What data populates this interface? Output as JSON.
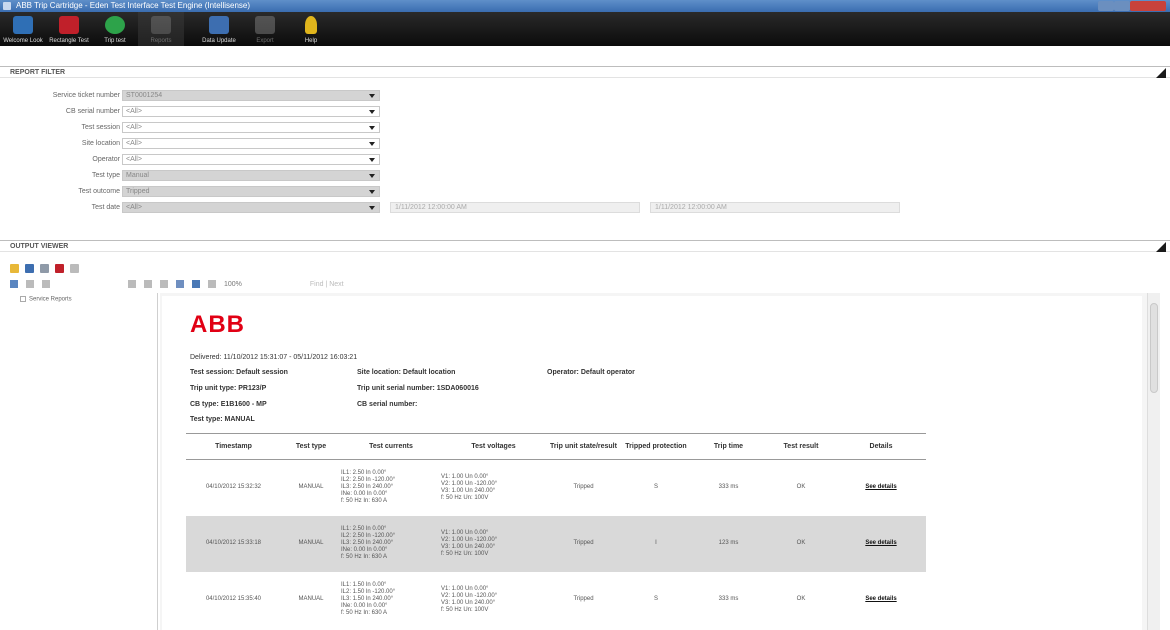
{
  "window": {
    "title": "ABB Trip Cartridge - Eden Test Interface Test Engine (Intellisense)"
  },
  "toolbar": {
    "buttons": [
      {
        "label": "Welcome Look",
        "color": "#2f6fb5"
      },
      {
        "label": "Rectangle Test",
        "color": "#c0202a"
      },
      {
        "label": "Trip test",
        "color": "#2da34a"
      },
      {
        "label": "Reports",
        "color": "#8a8a8a"
      },
      {
        "label": "Data Update",
        "color": "#3d6eb0"
      },
      {
        "label": "Export",
        "color": "#8a8a8a"
      },
      {
        "label": "Help",
        "color": "#e0b51c"
      }
    ]
  },
  "report_filter": {
    "title": "REPORT FILTER",
    "fields": [
      {
        "label": "Service ticket number",
        "value": "ST0001254"
      },
      {
        "label": "CB serial number",
        "value": "<All>"
      },
      {
        "label": "Test session",
        "value": "<All>"
      },
      {
        "label": "Site location",
        "value": "<All>"
      },
      {
        "label": "Operator",
        "value": "<All>"
      },
      {
        "label": "Test type",
        "value": "Manual"
      },
      {
        "label": "Test outcome",
        "value": "Tripped"
      },
      {
        "label": "Test date",
        "value": "<All>"
      }
    ],
    "date_from": "1/11/2012 12:00:00 AM",
    "date_to": "1/11/2012 12:00:00 AM"
  },
  "results_viewer": {
    "title": "OUTPUT VIEWER",
    "zoom": "100%",
    "find_placeholder": "Find | Next",
    "tree_item": "Service Reports"
  },
  "report": {
    "logo": "ABB",
    "period": "Delivered: 11/10/2012 15:31:07 - 05/11/2012 16:03:21",
    "info": {
      "test_session": "Test session: Default session",
      "site_location": "Site location: Default location",
      "operator": "Operator: Default operator",
      "trip_unit_type": "Trip unit type: PR123/P",
      "trip_unit_serial": "Trip unit serial number: 1SDA060016",
      "cb_type": "CB type: E1B1600 - MP",
      "cb_serial": "CB serial number:",
      "test_type": "Test type: MANUAL"
    },
    "columns": [
      "Timestamp",
      "Test type",
      "Test currents",
      "Test voltages",
      "Trip unit state/result",
      "Tripped protection",
      "Trip time",
      "Test result",
      "Details"
    ],
    "rows": [
      {
        "timestamp": "04/10/2012 15:32:32",
        "type": "MANUAL",
        "currents": "IL1: 2.50 ln 0.00°\nIL2: 2.50 ln -120.00°\nIL3: 2.50 ln 240.00°\nINe: 0.00 ln 0.00°\nf: 50 Hz In: 630 A",
        "voltages": "V1: 1.00 Un 0.00°\nV2: 1.00 Un -120.00°\nV3: 1.00 Un 240.00°\nf: 50 Hz Un: 100V",
        "state": "Tripped",
        "protection": "S",
        "trip_time": "333 ms",
        "result": "OK",
        "details": "See details",
        "shaded": false
      },
      {
        "timestamp": "04/10/2012 15:33:18",
        "type": "MANUAL",
        "currents": "IL1: 2.50 ln 0.00°\nIL2: 2.50 ln -120.00°\nIL3: 2.50 ln 240.00°\nINe: 0.00 ln 0.00°\nf: 50 Hz In: 630 A",
        "voltages": "V1: 1.00 Un 0.00°\nV2: 1.00 Un -120.00°\nV3: 1.00 Un 240.00°\nf: 50 Hz Un: 100V",
        "state": "Tripped",
        "protection": "I",
        "trip_time": "123 ms",
        "result": "OK",
        "details": "See details",
        "shaded": true
      },
      {
        "timestamp": "04/10/2012 15:35:40",
        "type": "MANUAL",
        "currents": "IL1: 1.50 ln 0.00°\nIL2: 1.50 ln -120.00°\nIL3: 1.50 ln 240.00°\nINe: 0.00 ln 0.00°\nf: 50 Hz In: 630 A",
        "voltages": "V1: 1.00 Un 0.00°\nV2: 1.00 Un -120.00°\nV3: 1.00 Un 240.00°\nf: 50 Hz Un: 100V",
        "state": "Tripped",
        "protection": "S",
        "trip_time": "333 ms",
        "result": "OK",
        "details": "See details",
        "shaded": false
      }
    ]
  }
}
